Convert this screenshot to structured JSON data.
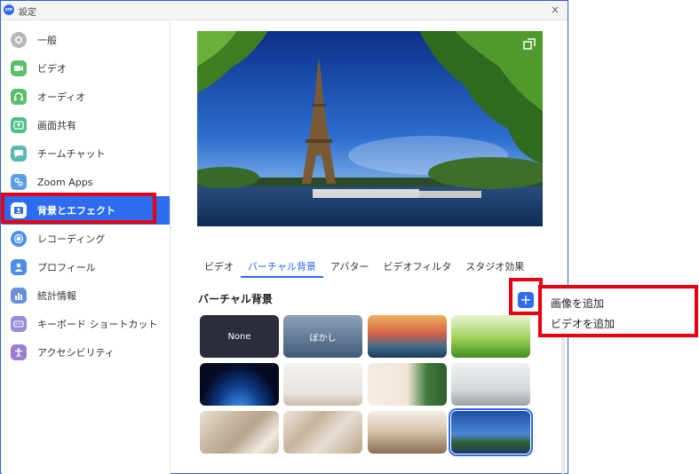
{
  "window": {
    "title": "設定",
    "logo_text": "zm",
    "close_glyph": "×"
  },
  "sidebar": {
    "items": [
      {
        "label": "一般",
        "icon": "gear-icon",
        "color": "#b8b8b8"
      },
      {
        "label": "ビデオ",
        "icon": "video-icon",
        "color": "#5bbf6a"
      },
      {
        "label": "オーディオ",
        "icon": "headphones-icon",
        "color": "#5bbf6a"
      },
      {
        "label": "画面共有",
        "icon": "share-screen-icon",
        "color": "#4dbf86"
      },
      {
        "label": "チームチャット",
        "icon": "chat-icon",
        "color": "#58b9b0"
      },
      {
        "label": "Zoom Apps",
        "icon": "apps-icon",
        "color": "#5aa0e6"
      },
      {
        "label": "背景とエフェクト",
        "icon": "background-icon",
        "color": "#2d6bf0"
      },
      {
        "label": "レコーディング",
        "icon": "record-icon",
        "color": "#4d8fe8"
      },
      {
        "label": "プロフィール",
        "icon": "profile-icon",
        "color": "#4d8fe8"
      },
      {
        "label": "統計情報",
        "icon": "stats-icon",
        "color": "#6a8fdc"
      },
      {
        "label": "キーボード ショートカット",
        "icon": "keyboard-icon",
        "color": "#9a8bd8"
      },
      {
        "label": "アクセシビリティ",
        "icon": "accessibility-icon",
        "color": "#9a7fd0"
      }
    ],
    "active_index": 6
  },
  "tabs": [
    "ビデオ",
    "バーチャル背景",
    "アバター",
    "ビデオフィルタ",
    "スタジオ効果"
  ],
  "active_tab": 1,
  "section": {
    "title": "バーチャル背景",
    "add_glyph": "+"
  },
  "thumbnails": [
    {
      "label": "None",
      "kind": "none"
    },
    {
      "label": "ぼかし",
      "kind": "blur"
    },
    {
      "label": "",
      "kind": "bridge"
    },
    {
      "label": "",
      "kind": "grass"
    },
    {
      "label": "",
      "kind": "earth"
    },
    {
      "label": "",
      "kind": "room-frames"
    },
    {
      "label": "",
      "kind": "christmas"
    },
    {
      "label": "",
      "kind": "living-room"
    },
    {
      "label": "",
      "kind": "mosaic"
    },
    {
      "label": "",
      "kind": "mosaic2"
    },
    {
      "label": "",
      "kind": "kitchen"
    },
    {
      "label": "",
      "kind": "eiffel-small"
    }
  ],
  "selected_thumbnail": 11,
  "popup": {
    "items": [
      "画像を追加",
      "ビデオを追加"
    ]
  },
  "colors": {
    "accent": "#2d6bf0",
    "highlight_red": "#e50012"
  }
}
